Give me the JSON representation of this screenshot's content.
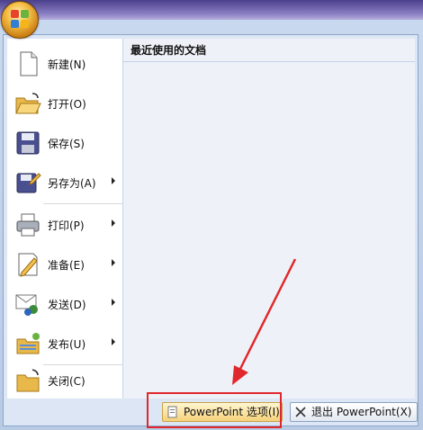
{
  "office_button": {
    "name": "office-button"
  },
  "recent": {
    "title": "最近使用的文档"
  },
  "menu": {
    "items": [
      {
        "label": "新建(N)",
        "icon": "new-document-icon",
        "submenu": false
      },
      {
        "label": "打开(O)",
        "icon": "open-folder-icon",
        "submenu": false
      },
      {
        "label": "保存(S)",
        "icon": "save-disk-icon",
        "submenu": false
      },
      {
        "label": "另存为(A)",
        "icon": "save-as-icon",
        "submenu": true
      },
      {
        "label": "打印(P)",
        "icon": "printer-icon",
        "submenu": true
      },
      {
        "label": "准备(E)",
        "icon": "prepare-icon",
        "submenu": true
      },
      {
        "label": "发送(D)",
        "icon": "send-icon",
        "submenu": true
      },
      {
        "label": "发布(U)",
        "icon": "publish-icon",
        "submenu": true
      },
      {
        "label": "关闭(C)",
        "icon": "close-folder-icon",
        "submenu": false
      }
    ]
  },
  "footer": {
    "options_label": "PowerPoint 选项(I)",
    "exit_label": "退出 PowerPoint(X)"
  },
  "annotation": {
    "color": "#e0282c"
  }
}
